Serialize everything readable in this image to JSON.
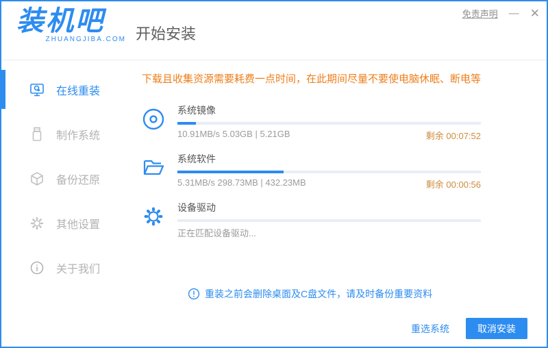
{
  "window": {
    "title": "开始安装",
    "disclaimer": "免责声明",
    "minimize_glyph": "—",
    "close_glyph": "✕"
  },
  "logo": {
    "name": "装机吧",
    "domain": "ZHUANGJIBA.COM"
  },
  "sidebar": {
    "items": [
      {
        "label": "在线重装",
        "icon": "monitor-icon",
        "active": true
      },
      {
        "label": "制作系统",
        "icon": "usb-icon",
        "active": false
      },
      {
        "label": "备份还原",
        "icon": "cube-icon",
        "active": false
      },
      {
        "label": "其他设置",
        "icon": "gear-icon",
        "active": false
      },
      {
        "label": "关于我们",
        "icon": "info-icon",
        "active": false
      }
    ]
  },
  "main": {
    "warning": "下载且收集资源需要耗费一点时间，在此期间尽量不要使电脑休眠、断电等",
    "tasks": [
      {
        "name": "系统镜像",
        "icon": "disc-icon",
        "progress_percent": 6,
        "stats": "10.91MB/s 5.03GB | 5.21GB",
        "remaining": "剩余 00:07:52"
      },
      {
        "name": "系统软件",
        "icon": "folder-icon",
        "progress_percent": 35,
        "stats": "5.31MB/s 298.73MB | 432.23MB",
        "remaining": "剩余 00:00:56"
      },
      {
        "name": "设备驱动",
        "icon": "gear-icon",
        "progress_percent": 0,
        "stats": "正在匹配设备驱动...",
        "remaining": ""
      }
    ],
    "note": "重装之前会删除桌面及C盘文件，请及时备份重要资料"
  },
  "footer": {
    "reselect_label": "重选系统",
    "cancel_label": "取消安装"
  },
  "colors": {
    "primary_blue": "#2d8cf0",
    "warning_orange": "#ee7f1b",
    "remaining_orange": "#cd8c3e",
    "inactive_gray": "#c2c2c2"
  }
}
